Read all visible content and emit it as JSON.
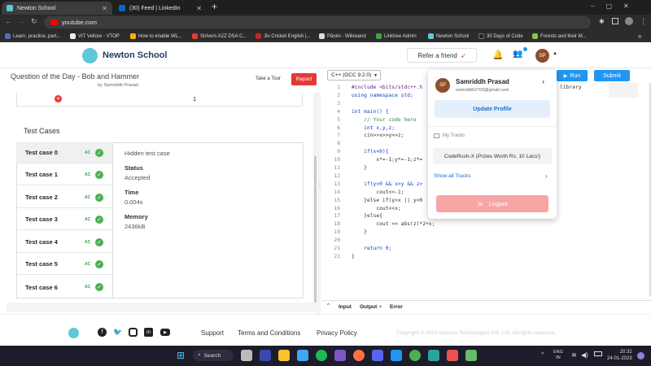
{
  "browser": {
    "tabs": [
      {
        "title": "Newton School",
        "active": true
      },
      {
        "title": "(30) Feed | LinkedIn",
        "active": false
      }
    ],
    "new_tab": "+",
    "url": "youtube.com",
    "bookmarks": [
      "Learn, practice, part...",
      "VIT Vellore - VTOP",
      "How to enable WL...",
      "Strivers A2Z DSA C...",
      "Jio Cricket English |...",
      "Pāṇini - Wikiwand",
      "Linktree Admin",
      "Newton School",
      "30 Days of Code",
      "Forests and their M..."
    ]
  },
  "header": {
    "brand": "Newton School",
    "refer": "Refer a friend",
    "avatar": "SP"
  },
  "problem": {
    "title": "Question of the Day - Bob and Hammer",
    "author": "by Samriddh Prasad",
    "take_tour": "Take a Tour",
    "report": "Report",
    "top_row_value": "1",
    "test_cases_heading": "Test Cases",
    "cases": [
      {
        "label": "Test case 0",
        "badge": "AC"
      },
      {
        "label": "Test case 1",
        "badge": "AC"
      },
      {
        "label": "Test case 2",
        "badge": "AC"
      },
      {
        "label": "Test case 3",
        "badge": "AC"
      },
      {
        "label": "Test case 4",
        "badge": "AC"
      },
      {
        "label": "Test case 5",
        "badge": "AC"
      },
      {
        "label": "Test case 6",
        "badge": "AC"
      }
    ],
    "detail": {
      "hidden": "Hidden test case",
      "status_label": "Status",
      "status": "Accepted",
      "time_label": "Time",
      "time": "0.004s",
      "memory_label": "Memory",
      "memory": "2436kB"
    }
  },
  "editor": {
    "language": "C++ (GCC 9.2.0)",
    "run": "Run",
    "submit": "Submit",
    "library": "library",
    "lines": [
      "#include <bits/stdc++.h",
      "using namespace std;",
      "",
      "int main() {",
      "    // Your code here",
      "    int x,y,z;",
      "    cin>>x>>y>>z;",
      "",
      "    if(x<0){",
      "        x*=-1;y*=-1;z*=",
      "    }",
      "",
      "    if(y>0 && x>y && z>",
      "        cout<<-1;",
      "    }else if(y>x || y<0",
      "        cout<<x;",
      "    }else{",
      "        cout << abs(z)*2+x;",
      "    }",
      "",
      "    return 0;",
      "}"
    ],
    "bottom_tabs": [
      "Input",
      "Output",
      "Error"
    ]
  },
  "profile_menu": {
    "avatar": "SP",
    "name": "Samriddh Prasad",
    "email": "samriddh2703@gmail.com",
    "update": "Update Profile",
    "my_tracks": "My Tracks",
    "track": "CodeRush-X (Prizes Worth Rs. 10 Lacs!)",
    "show_all": "Show all Tracks",
    "logout": "Logout"
  },
  "footer": {
    "links": [
      "Support",
      "Terms and Conditions",
      "Privacy Policy"
    ],
    "copyright": "Copyright © 2023 Incanus Technologies Pvt. Ltd. All rights reserved."
  },
  "taskbar": {
    "search": "Search",
    "lang": "ENG",
    "region": "IN",
    "time": "20:32",
    "date": "24-01-2023"
  },
  "colors": {
    "accent_blue": "#2196f3",
    "report_red": "#e53935",
    "ac_green": "#4caf50",
    "logout_red": "#f8a5a5"
  }
}
